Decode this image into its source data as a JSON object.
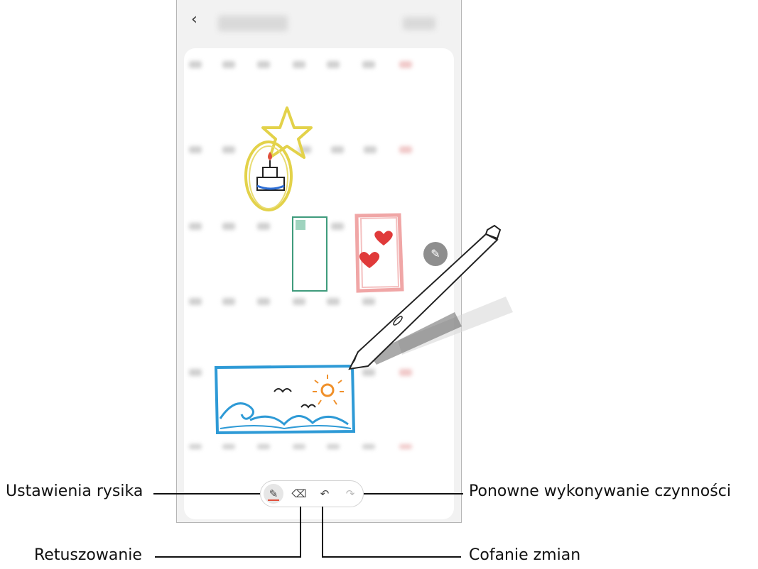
{
  "toolbar": {
    "pen_settings_icon": "pen-icon",
    "eraser_icon": "eraser-icon",
    "undo_icon": "undo-icon",
    "redo_icon": "redo-icon",
    "accent_color": "#e0503c"
  },
  "callouts": {
    "pen_settings": "Ustawienia rysika",
    "eraser": "Retuszowanie",
    "undo": "Cofanie zmian",
    "redo": "Ponowne wykonywanie czynności"
  },
  "colors": {
    "drawing_yellow": "#e3d24a",
    "drawing_blue": "#2e9ad6",
    "drawing_pink": "#f0a6a6",
    "drawing_green": "#3f9b7c",
    "sun_orange": "#f0902a",
    "heart_red": "#e03a3a"
  }
}
